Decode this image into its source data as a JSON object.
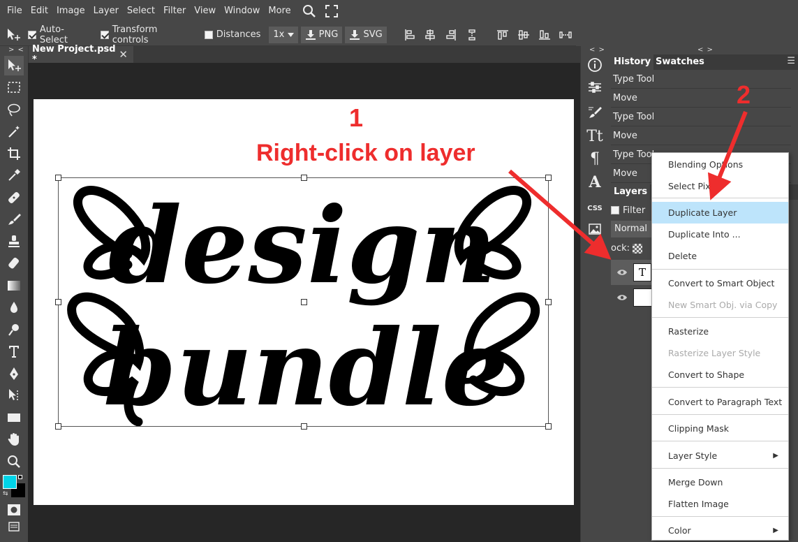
{
  "menu": {
    "items": [
      "File",
      "Edit",
      "Image",
      "Layer",
      "Select",
      "Filter",
      "View",
      "Window",
      "More"
    ],
    "icons": [
      "search-icon",
      "fullscreen-icon"
    ]
  },
  "options": {
    "auto_select": {
      "label": "Auto-Select",
      "checked": true
    },
    "transform_controls": {
      "label": "Transform controls",
      "checked": true
    },
    "distances": {
      "label": "Distances",
      "checked": false
    },
    "zoom": "1x",
    "png_label": "PNG",
    "svg_label": "SVG"
  },
  "collapse_glyph": "> <",
  "collapse_glyph_right": "< >",
  "document": {
    "tab_title": "New Project.psd *",
    "close_glyph": "✕",
    "lettering": [
      "design",
      "bundle"
    ]
  },
  "annotations": {
    "step1": "1",
    "step1_text": "Right-click on layer",
    "step2": "2",
    "color": "#ee2d2d"
  },
  "strip_icons": [
    "info-icon",
    "adjustments-icon",
    "brush-settings-icon",
    "character-icon",
    "paragraph-icon",
    "glyphs-icon",
    "css-icon",
    "image-icon"
  ],
  "history": {
    "tabs": [
      "History",
      "Swatches"
    ],
    "items": [
      "Type Tool",
      "Move",
      "Type Tool",
      "Move",
      "Type Tool",
      "Move"
    ]
  },
  "layers": {
    "tab": "Layers",
    "filter_label": "Filter",
    "blend_mode": "Normal",
    "lock_label": "ock:",
    "text_layer_thumb": "T"
  },
  "context_menu": {
    "items": [
      {
        "label": "Blending Options",
        "state": "normal"
      },
      {
        "label": "Select Pixels",
        "state": "normal"
      },
      {
        "label": "Duplicate Layer",
        "state": "highlighted"
      },
      {
        "label": "Duplicate Into ...",
        "state": "normal"
      },
      {
        "label": "Delete",
        "state": "normal"
      },
      {
        "label": "Convert to Smart Object",
        "state": "normal"
      },
      {
        "label": "New Smart Obj. via Copy",
        "state": "disabled"
      },
      {
        "label": "Rasterize",
        "state": "normal"
      },
      {
        "label": "Rasterize Layer Style",
        "state": "disabled"
      },
      {
        "label": "Convert to Shape",
        "state": "normal"
      },
      {
        "label": "Convert to Paragraph Text",
        "state": "normal"
      },
      {
        "label": "Clipping Mask",
        "state": "normal"
      },
      {
        "label": "Layer Style",
        "state": "normal",
        "submenu": true
      },
      {
        "label": "Merge Down",
        "state": "normal"
      },
      {
        "label": "Flatten Image",
        "state": "normal"
      },
      {
        "label": "Color",
        "state": "normal",
        "submenu": true
      }
    ],
    "submenu_glyph": "▶"
  },
  "colors": {
    "foreground": "#00d4e8",
    "background": "#000000",
    "highlight": "#bde4fb"
  }
}
